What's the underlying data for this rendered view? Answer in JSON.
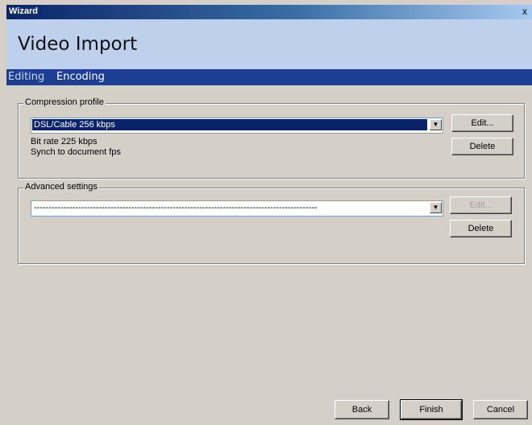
{
  "window": {
    "title": "Wizard",
    "close_glyph": "x"
  },
  "header": {
    "title": "Video Import"
  },
  "steps": [
    {
      "label": "Editing",
      "active": false
    },
    {
      "label": "Encoding",
      "active": true
    }
  ],
  "compression": {
    "legend": "Compression profile",
    "selected": "DSL/Cable 256 kbps",
    "bitrate": "Bit rate 225 kbps",
    "sync": "Synch to document fps",
    "edit_label": "Edit...",
    "delete_label": "Delete"
  },
  "advanced": {
    "legend": "Advanced settings",
    "selected": "------------------------------------------------------------------------------------------------",
    "edit_label": "Edit...",
    "delete_label": "Delete"
  },
  "footer": {
    "back_label": "Back",
    "finish_label": "Finish",
    "cancel_label": "Cancel"
  },
  "colors": {
    "titlebar": "#0a246a",
    "header_bg": "#bdd0ec",
    "steps_bar": "#1c3f94",
    "dialog_bg": "#d4d0c8",
    "selection": "#0a246a"
  }
}
